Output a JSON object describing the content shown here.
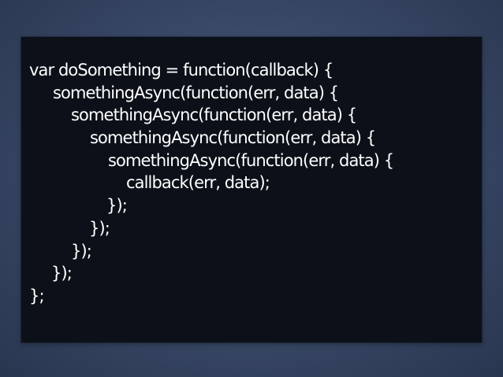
{
  "slide": {
    "code_lines": [
      "var doSomething = function(callback) {",
      "somethingAsync(function(err, data) {",
      "somethingAsync(function(err, data) {",
      "somethingAsync(function(err, data) {",
      "somethingAsync(function(err, data) {",
      "callback(err, data);",
      "});",
      "});",
      "});",
      "});",
      "};"
    ]
  }
}
